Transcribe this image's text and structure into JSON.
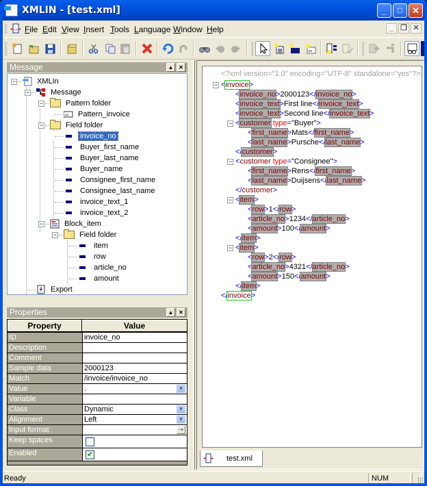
{
  "window": {
    "title": "XMLIN - [test.xml]",
    "minimize": "_",
    "maximize": "□",
    "close": "✕"
  },
  "menu": {
    "items": [
      {
        "label": "File",
        "icon": "file-menu"
      },
      {
        "label": "Edit"
      },
      {
        "label": "View"
      },
      {
        "label": "Insert"
      },
      {
        "label": "Tools"
      },
      {
        "label": "Language"
      },
      {
        "label": "Window"
      },
      {
        "label": "Help"
      }
    ],
    "mdi_minimize": "_",
    "mdi_restore": "❐",
    "mdi_close": "✕"
  },
  "toolbar": {
    "buttons": [
      "new-document",
      "open-folder",
      "save",
      "open-project",
      "cut",
      "copy",
      "paste",
      "delete",
      "undo",
      "redo",
      "find",
      "find-previous",
      "find-next",
      "select-pointer",
      "insert-element",
      "insert-block",
      "insert-pattern",
      "generate",
      "validate",
      "run",
      "step",
      "test-run",
      "export"
    ]
  },
  "message_pane": {
    "title": "Message",
    "tree": [
      {
        "label": "XMLIn",
        "icon": "xmlin-icon",
        "level": 0,
        "expanded": true
      },
      {
        "label": "Message",
        "icon": "message-icon",
        "level": 1,
        "expanded": true
      },
      {
        "label": "Pattern folder",
        "icon": "folder-icon",
        "level": 2,
        "expanded": true
      },
      {
        "label": "Pattern_invoice",
        "icon": "pattern-icon",
        "level": 3
      },
      {
        "label": "Field folder",
        "icon": "folder-icon",
        "level": 2,
        "expanded": true
      },
      {
        "label": "invoice_no",
        "icon": "field-icon",
        "level": 3,
        "selected": true
      },
      {
        "label": "Buyer_first_name",
        "icon": "field-icon",
        "level": 3
      },
      {
        "label": "Buyer_last_name",
        "icon": "field-icon",
        "level": 3
      },
      {
        "label": "Buyer_name",
        "icon": "field-icon",
        "level": 3
      },
      {
        "label": "Consignee_first_name",
        "icon": "field-icon",
        "level": 3
      },
      {
        "label": "Consignee_last_name",
        "icon": "field-icon",
        "level": 3
      },
      {
        "label": "invoice_text_1",
        "icon": "field-icon",
        "level": 3
      },
      {
        "label": "invoice_text_2",
        "icon": "field-icon",
        "level": 3
      },
      {
        "label": "Block_item",
        "icon": "block-icon",
        "level": 2,
        "expanded": true
      },
      {
        "label": "Field folder",
        "icon": "folder-icon",
        "level": 3,
        "expanded": true
      },
      {
        "label": "item",
        "icon": "field-icon",
        "level": 4
      },
      {
        "label": "row",
        "icon": "field-icon",
        "level": 4
      },
      {
        "label": "article_no",
        "icon": "field-icon",
        "level": 4
      },
      {
        "label": "amount",
        "icon": "field-icon",
        "level": 4
      },
      {
        "label": "Export",
        "icon": "export-icon",
        "level": 1
      }
    ]
  },
  "properties_pane": {
    "title": "Properties",
    "headers": {
      "property": "Property",
      "value": "Value"
    },
    "rows": [
      {
        "key": "ID",
        "value": "invoice_no",
        "control": "text"
      },
      {
        "key": "Description",
        "value": "",
        "control": "text"
      },
      {
        "key": "Comment",
        "value": "",
        "control": "text"
      },
      {
        "key": "Sample data",
        "value": "2000123",
        "control": "text"
      },
      {
        "key": "Match",
        "value": "/invoice/invoice_no",
        "control": "text"
      },
      {
        "key": "Value",
        "value": ".",
        "control": "dropdown"
      },
      {
        "key": "Variable",
        "value": "",
        "control": "text"
      },
      {
        "key": "Class",
        "value": "Dynamic",
        "control": "dropdown"
      },
      {
        "key": "Alignment",
        "value": "Left",
        "control": "dropdown"
      },
      {
        "key": "Input format",
        "value": "",
        "control": "button"
      },
      {
        "key": "Keep spaces",
        "value": false,
        "control": "checkbox"
      },
      {
        "key": "Enabled",
        "value": true,
        "control": "checkbox"
      }
    ]
  },
  "editor": {
    "declaration": "<?xml version=\"1.0\" encoding=\"UTF-8\" standalone=\"yes\"?>",
    "lines": [
      {
        "indent": 0,
        "fold": true,
        "parts": [
          [
            "br",
            "<"
          ],
          [
            "tn-green",
            "invoice"
          ],
          [
            "br",
            ">"
          ]
        ]
      },
      {
        "indent": 1,
        "parts": [
          [
            "br",
            "<"
          ],
          [
            "tn-box",
            "invoice_no"
          ],
          [
            "br",
            ">"
          ],
          [
            "tx",
            "2000123"
          ],
          [
            "br",
            "</"
          ],
          [
            "tn-box",
            "invoice_no"
          ],
          [
            "br",
            ">"
          ]
        ]
      },
      {
        "indent": 1,
        "parts": [
          [
            "br",
            "<"
          ],
          [
            "tn-box",
            "invoice_text"
          ],
          [
            "br",
            ">"
          ],
          [
            "tx",
            "First line"
          ],
          [
            "br",
            "</"
          ],
          [
            "tn-box",
            "invoice_text"
          ],
          [
            "br",
            ">"
          ]
        ]
      },
      {
        "indent": 1,
        "parts": [
          [
            "br",
            "<"
          ],
          [
            "tn-box",
            "invoice_text"
          ],
          [
            "br",
            ">"
          ],
          [
            "tx",
            "Second line"
          ],
          [
            "br",
            "</"
          ],
          [
            "tn-box",
            "invoice_text"
          ],
          [
            "br",
            ">"
          ]
        ]
      },
      {
        "indent": 1,
        "fold": true,
        "parts": [
          [
            "br",
            "<"
          ],
          [
            "tn-box",
            "customer"
          ],
          [
            "tx",
            " "
          ],
          [
            "an",
            "type"
          ],
          [
            "br",
            "="
          ],
          [
            "av",
            "\"Buyer\""
          ],
          [
            "br",
            ">"
          ]
        ]
      },
      {
        "indent": 2,
        "parts": [
          [
            "br",
            "<"
          ],
          [
            "tn-box",
            "first_name"
          ],
          [
            "br",
            ">"
          ],
          [
            "tx",
            "Mats"
          ],
          [
            "br",
            "</"
          ],
          [
            "tn-box",
            "first_name"
          ],
          [
            "br",
            ">"
          ]
        ]
      },
      {
        "indent": 2,
        "parts": [
          [
            "br",
            "<"
          ],
          [
            "tn-box",
            "last_name"
          ],
          [
            "br",
            ">"
          ],
          [
            "tx",
            "Pursche"
          ],
          [
            "br",
            "</"
          ],
          [
            "tn-box",
            "last_name"
          ],
          [
            "br",
            ">"
          ]
        ]
      },
      {
        "indent": 1,
        "parts": [
          [
            "br",
            "</"
          ],
          [
            "tn-box",
            "customer"
          ],
          [
            "br",
            ">"
          ]
        ]
      },
      {
        "indent": 1,
        "fold": true,
        "parts": [
          [
            "br",
            "<"
          ],
          [
            "tn",
            "customer"
          ],
          [
            "tx",
            " "
          ],
          [
            "an",
            "type"
          ],
          [
            "br",
            "="
          ],
          [
            "av",
            "\"Consignee\""
          ],
          [
            "br",
            ">"
          ]
        ]
      },
      {
        "indent": 2,
        "parts": [
          [
            "br",
            "<"
          ],
          [
            "tn-box",
            "first_name"
          ],
          [
            "br",
            ">"
          ],
          [
            "tx",
            "Rens"
          ],
          [
            "br",
            "</"
          ],
          [
            "tn-box",
            "first_name"
          ],
          [
            "br",
            ">"
          ]
        ]
      },
      {
        "indent": 2,
        "parts": [
          [
            "br",
            "<"
          ],
          [
            "tn-box",
            "last_name"
          ],
          [
            "br",
            ">"
          ],
          [
            "tx",
            "Duijsens"
          ],
          [
            "br",
            "</"
          ],
          [
            "tn-box",
            "last_name"
          ],
          [
            "br",
            ">"
          ]
        ]
      },
      {
        "indent": 1,
        "parts": [
          [
            "br",
            "</"
          ],
          [
            "tn",
            "customer"
          ],
          [
            "br",
            ">"
          ]
        ]
      },
      {
        "indent": 1,
        "fold": true,
        "parts": [
          [
            "br",
            "<"
          ],
          [
            "tn-box",
            "item"
          ],
          [
            "br",
            ">"
          ]
        ]
      },
      {
        "indent": 2,
        "parts": [
          [
            "br",
            "<"
          ],
          [
            "tn-box",
            "row"
          ],
          [
            "br",
            ">"
          ],
          [
            "tx",
            "1"
          ],
          [
            "br",
            "</"
          ],
          [
            "tn-box",
            "row"
          ],
          [
            "br",
            ">"
          ]
        ]
      },
      {
        "indent": 2,
        "parts": [
          [
            "br",
            "<"
          ],
          [
            "tn-box",
            "article_no"
          ],
          [
            "br",
            ">"
          ],
          [
            "tx",
            "1234"
          ],
          [
            "br",
            "</"
          ],
          [
            "tn-box",
            "article_no"
          ],
          [
            "br",
            ">"
          ]
        ]
      },
      {
        "indent": 2,
        "parts": [
          [
            "br",
            "<"
          ],
          [
            "tn-box",
            "amount"
          ],
          [
            "br",
            ">"
          ],
          [
            "tx",
            "100"
          ],
          [
            "br",
            "</"
          ],
          [
            "tn-box",
            "amount"
          ],
          [
            "br",
            ">"
          ]
        ]
      },
      {
        "indent": 1,
        "parts": [
          [
            "br",
            "</"
          ],
          [
            "tn-box",
            "item"
          ],
          [
            "br",
            ">"
          ]
        ]
      },
      {
        "indent": 1,
        "fold": true,
        "parts": [
          [
            "br",
            "<"
          ],
          [
            "tn-box",
            "item"
          ],
          [
            "br",
            ">"
          ]
        ]
      },
      {
        "indent": 2,
        "parts": [
          [
            "br",
            "<"
          ],
          [
            "tn-box",
            "row"
          ],
          [
            "br",
            ">"
          ],
          [
            "tx",
            "2"
          ],
          [
            "br",
            "</"
          ],
          [
            "tn-box",
            "row"
          ],
          [
            "br",
            ">"
          ]
        ]
      },
      {
        "indent": 2,
        "parts": [
          [
            "br",
            "<"
          ],
          [
            "tn-box",
            "article_no"
          ],
          [
            "br",
            ">"
          ],
          [
            "tx",
            "4321"
          ],
          [
            "br",
            "</"
          ],
          [
            "tn-box",
            "article_no"
          ],
          [
            "br",
            ">"
          ]
        ]
      },
      {
        "indent": 2,
        "parts": [
          [
            "br",
            "<"
          ],
          [
            "tn-box",
            "amount"
          ],
          [
            "br",
            ">"
          ],
          [
            "tx",
            "150"
          ],
          [
            "br",
            "</"
          ],
          [
            "tn-box",
            "amount"
          ],
          [
            "br",
            ">"
          ]
        ]
      },
      {
        "indent": 1,
        "parts": [
          [
            "br",
            "</"
          ],
          [
            "tn-box",
            "item"
          ],
          [
            "br",
            ">"
          ]
        ]
      },
      {
        "indent": 0,
        "parts": [
          [
            "br",
            "</"
          ],
          [
            "tn-green",
            "invoice"
          ],
          [
            "br",
            ">"
          ]
        ]
      }
    ]
  },
  "doc_tab": {
    "label": "test.xml"
  },
  "status": {
    "text": "Ready",
    "num": "NUM"
  }
}
